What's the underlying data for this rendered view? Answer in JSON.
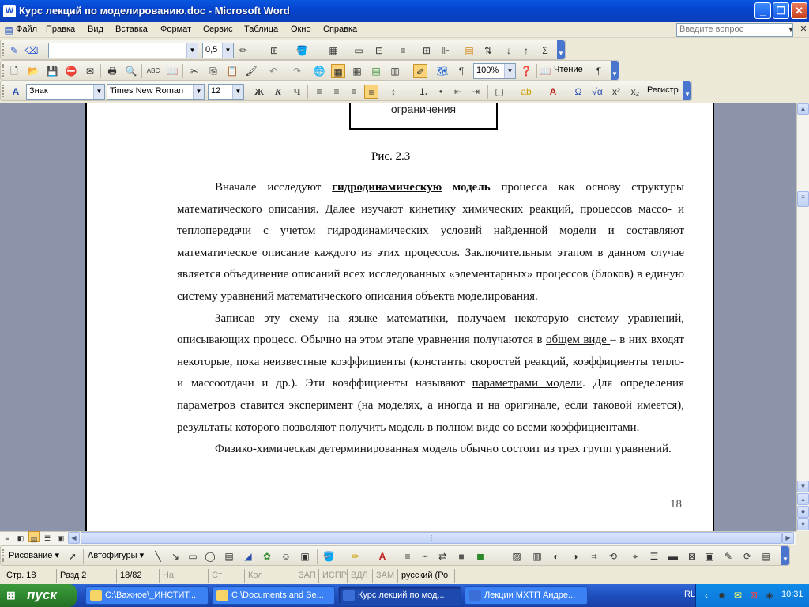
{
  "window": {
    "title": "Курс лекций по моделированию.doc - Microsoft Word"
  },
  "menu": {
    "items": [
      "Файл",
      "Правка",
      "Вид",
      "Вставка",
      "Формат",
      "Сервис",
      "Таблица",
      "Окно",
      "Справка"
    ],
    "ask_placeholder": "Введите вопрос"
  },
  "toolbar1": {
    "line_width": "0,5"
  },
  "toolbar2": {
    "zoom": "100%",
    "reading_label": "Чтение"
  },
  "toolbar3": {
    "style": "Знак",
    "font": "Times New Roman",
    "size": "12",
    "case_label": "Регистр"
  },
  "document": {
    "figure_box_text": "ограничения",
    "caption": "Рис. 2.3",
    "p1_a": "Вначале исследуют ",
    "p1_b": "гидродинамическую",
    "p1_c": " модель",
    "p1_d": " процесса как основу структуры математического описания. Далее изучают кинетику химических реакций, процессов массо- и теплопередачи с учетом гидродинамических условий найденной модели и составляют математическое описание каждого из этих процессов. Заключительным этапом в данном случае является объединение описаний всех исследованных «элементарных» процессов (блоков) в единую систему уравнений математического описания объекта моделирования.",
    "p2_a": "Записав эту схему на языке математики, получаем некоторую систему уравнений, описывающих процесс. Обычно на этом этапе уравнения получаются в ",
    "p2_b": "общем виде ",
    "p2_c": "– в них входят некоторые, пока неизвестные коэффициенты (константы скоростей реакций, коэффициенты тепло- и массоотдачи и др.). Эти коэффициенты называют ",
    "p2_d": "параметрами модели",
    "p2_e": ". Для определения параметров ставится эксперимент (на моделях, а иногда и на оригинале, если таковой имеется), результаты которого позволяют получить модель в полном виде со всеми коэффициентами.",
    "p3": "Физико-химическая детерминированная модель обычно состоит из трех групп уравнений.",
    "page_number": "18"
  },
  "drawing_toolbar": {
    "drawing_label": "Рисование",
    "autoshapes_label": "Автофигуры"
  },
  "status": {
    "page": "Стр. 18",
    "section": "Разд 2",
    "pages": "18/82",
    "at": "На",
    "line": "Ст",
    "col": "Кол",
    "rec": "ЗАП",
    "trk": "ИСПР",
    "ext": "ВДЛ",
    "ovr": "ЗАМ",
    "language": "русский (Ро"
  },
  "taskbar": {
    "start_label": "пуск",
    "tasks": [
      "C:\\Важное\\_ИНСТИТ...",
      "C:\\Documents and Se...",
      "Курс лекций по мод...",
      "Лекции МХТП Андре..."
    ],
    "lang": "RL",
    "time": "10:31"
  }
}
